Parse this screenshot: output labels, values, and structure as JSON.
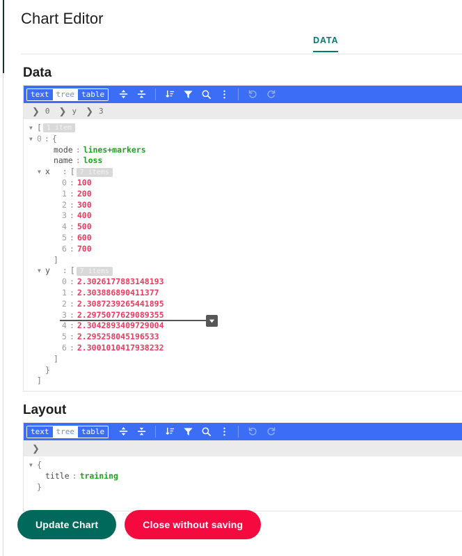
{
  "app": {
    "title": "Chart Editor"
  },
  "tabs": [
    {
      "label": "DATA",
      "active": true
    }
  ],
  "colors": {
    "accent_teal": "#027a6e",
    "toolbar_blue": "#3c6df5",
    "string_green": "#1ea11e",
    "number_red": "#ee3a5c",
    "update_button": "#00695c",
    "close_button": "#f50a40"
  },
  "sections": {
    "data": {
      "label": "Data",
      "toolbar": {
        "modes": [
          {
            "label": "text",
            "active": false
          },
          {
            "label": "tree",
            "active": true
          },
          {
            "label": "table",
            "active": false
          }
        ],
        "icons": [
          {
            "name": "expand-all-icon",
            "title": "Expand all"
          },
          {
            "name": "collapse-all-icon",
            "title": "Collapse all"
          },
          {
            "name": "sort-icon",
            "title": "Sort"
          },
          {
            "name": "filter-icon",
            "title": "Filter"
          },
          {
            "name": "search-icon",
            "title": "Search"
          },
          {
            "name": "kebab-menu-icon",
            "title": "More"
          },
          {
            "name": "undo-icon",
            "title": "Undo"
          },
          {
            "name": "redo-icon",
            "title": "Redo"
          }
        ]
      },
      "breadcrumb": [
        "0",
        "y",
        "3"
      ],
      "root_badge": "1 item",
      "trace": {
        "index_label": "0",
        "mode": {
          "key": "mode",
          "value": "lines+markers"
        },
        "name": {
          "key": "name",
          "value": "loss"
        },
        "x": {
          "key": "x",
          "badge": "7 items",
          "values": [
            "100",
            "200",
            "300",
            "400",
            "500",
            "600",
            "700"
          ]
        },
        "y": {
          "key": "y",
          "badge": "7 items",
          "values": [
            "2.3026177883148193",
            "2.303886890411377",
            "2.3087239265441895",
            "2.2975077629089355",
            "2.3042893409729004",
            "2.295258045196533",
            "2.3001010417938232"
          ]
        }
      }
    },
    "layout": {
      "label": "Layout",
      "toolbar": {
        "modes": [
          {
            "label": "text",
            "active": false
          },
          {
            "label": "tree",
            "active": true
          },
          {
            "label": "table",
            "active": false
          }
        ]
      },
      "breadcrumb": [],
      "entries": [
        {
          "key": "title",
          "value": "training"
        }
      ]
    }
  },
  "footer": {
    "update_label": "Update Chart",
    "close_label": "Close without saving"
  },
  "chart_data": {
    "type": "line",
    "title": "training",
    "series": [
      {
        "name": "loss",
        "mode": "lines+markers",
        "x": [
          100,
          200,
          300,
          400,
          500,
          600,
          700
        ],
        "y": [
          2.3026177883148193,
          2.303886890411377,
          2.3087239265441895,
          2.2975077629089355,
          2.3042893409729004,
          2.295258045196533,
          2.3001010417938232
        ]
      }
    ],
    "xlabel": "",
    "ylabel": ""
  }
}
